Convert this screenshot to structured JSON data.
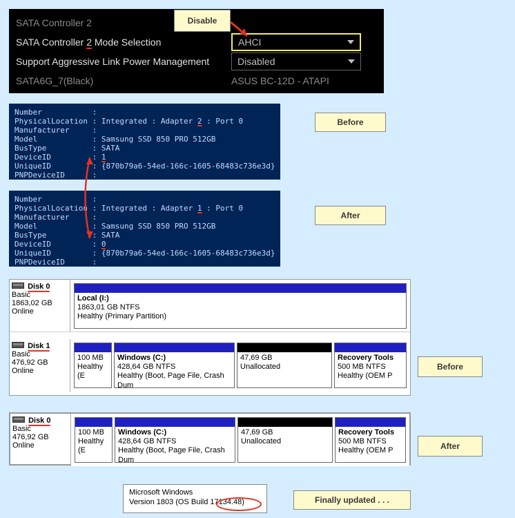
{
  "bios": {
    "title": "SATA Controller 2",
    "modeLabelPrefix": "SATA Controller ",
    "modeLabelNum": "2",
    "modeLabelSuffix": " Mode Selection",
    "modeValue": "AHCI",
    "aggrLabel": "Support Aggressive Link Power Management",
    "aggrValue": "Disabled",
    "portLabel": "SATA6G_7(Black)",
    "deviceInfo": "ASUS   BC-12D - ATAPI",
    "callout": "Disable"
  },
  "ps_before": {
    "number": "Number           :",
    "loc": "PhysicalLocation : Integrated : Adapter ",
    "locNum": "2",
    "locEnd": " : Port 0",
    "mfr": "Manufacturer     :",
    "model": "Model            : Samsung SSD 850 PRO 512GB",
    "bus": "BusType          : SATA",
    "did": "DeviceID         : ",
    "didVal": "1",
    "uid": "UniqueID         : {870b79a6-54ed-166c-1605-68483c736e3d}",
    "pnp": "PNPDeviceID      :"
  },
  "ps_after": {
    "number": "Number           :",
    "loc": "PhysicalLocation : Integrated : Adapter ",
    "locNum": "1",
    "locEnd": " : Port 0",
    "mfr": "Manufacturer     :",
    "model": "Model            : Samsung SSD 850 PRO 512GB",
    "bus": "BusType          : SATA",
    "did": "DeviceID         : ",
    "didVal": "0",
    "uid": "UniqueID         : {870b79a6-54ed-166c-1605-68483c736e3d}",
    "pnp": "PNPDeviceID      :"
  },
  "labels": {
    "before": "Before",
    "after": "After",
    "final": "Finally updated  . . ."
  },
  "dm": {
    "d0": {
      "name": "Disk 0",
      "type": "Basic",
      "size": "1863,02 GB",
      "status": "Online"
    },
    "d1": {
      "name": "Disk 1",
      "type": "Basic",
      "size": "476,92 GB",
      "status": "Online"
    },
    "d0b": {
      "name": "Disk 0",
      "type": "Basic",
      "size": "476,92 GB",
      "status": "Online"
    },
    "local": {
      "title": "Local  (I:)",
      "line1": "1863,01 GB NTFS",
      "line2": "Healthy (Primary Partition)"
    },
    "p1": {
      "line1": "100 MB",
      "line2": "Healthy (E"
    },
    "p2": {
      "title": "Windows  (C:)",
      "line1": "428,64 GB NTFS",
      "line2": "Healthy (Boot, Page File, Crash Dum"
    },
    "p3": {
      "line1": "47,69 GB",
      "line2": "Unallocated"
    },
    "p4": {
      "title": "Recovery Tools",
      "line1": "500 MB NTFS",
      "line2": "Healthy (OEM P"
    }
  },
  "winver": {
    "line1": "Microsoft Windows",
    "line2a": "Version 1803 (OS Build ",
    "line2b": "17134.48)"
  }
}
